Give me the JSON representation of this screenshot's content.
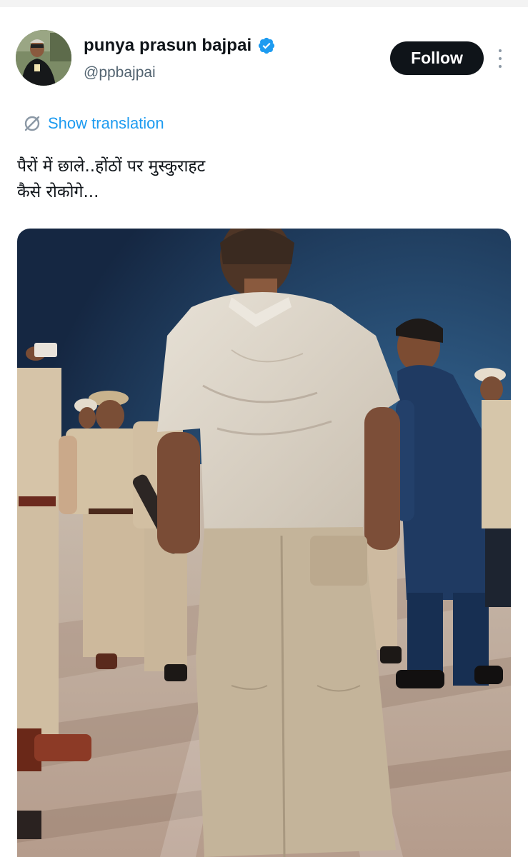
{
  "author": {
    "display_name": "punya prasun bajpai",
    "handle": "@ppbajpai",
    "verified": true,
    "avatar_icon": "profile-photo",
    "verified_icon": "verified-badge-icon"
  },
  "actions": {
    "follow_label": "Follow",
    "more_icon": "more-vertical-icon"
  },
  "translation": {
    "label": "Show translation",
    "icon": "translate-icon"
  },
  "tweet": {
    "lines": [
      "पैरों में छाले..होंठों पर मुस्कुराहट",
      "कैसे रोकोगे..."
    ]
  },
  "media": {
    "type": "photo"
  },
  "colors": {
    "link": "#1d9bf0",
    "button_bg": "#0f1419",
    "verified": "#1d9bf0",
    "handle": "#536471"
  }
}
